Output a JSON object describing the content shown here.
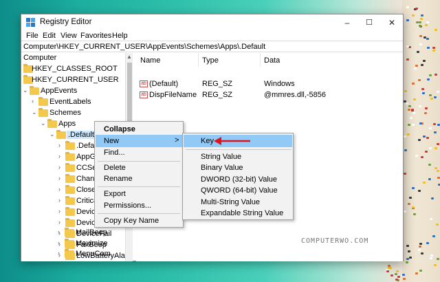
{
  "window": {
    "title": "Registry Editor",
    "minimize": "–",
    "maximize": "☐",
    "close": "✕"
  },
  "menubar": [
    "File",
    "Edit",
    "View",
    "Favorites",
    "Help"
  ],
  "address": "Computer\\HKEY_CURRENT_USER\\AppEvents\\Schemes\\Apps\\.Default",
  "tree": {
    "items": [
      {
        "label": "Computer",
        "indent": 0
      },
      {
        "label": "HKEY_CLASSES_ROOT",
        "indent": 1,
        "arrow": ">"
      },
      {
        "label": "HKEY_CURRENT_USER",
        "indent": 1,
        "arrow": "v"
      },
      {
        "label": "AppEvents",
        "indent": 2,
        "arrow": "v"
      },
      {
        "label": "EventLabels",
        "indent": 3,
        "arrow": ">"
      },
      {
        "label": "Schemes",
        "indent": 3,
        "arrow": "v"
      },
      {
        "label": "Apps",
        "indent": 4,
        "arrow": "v"
      },
      {
        "label": ".Default",
        "indent": 5,
        "arrow": "v",
        "selected": true
      },
      {
        "label": ".Default",
        "indent": 6,
        "arrow": ">"
      },
      {
        "label": "AppGPF",
        "indent": 6,
        "arrow": ">"
      },
      {
        "label": "CCSelect",
        "indent": 6,
        "arrow": ">"
      },
      {
        "label": "ChangeTheme",
        "indent": 6,
        "arrow": ">"
      },
      {
        "label": "Close",
        "indent": 6,
        "arrow": ">"
      },
      {
        "label": "CriticalBatteryAlarm",
        "indent": 6,
        "arrow": ">"
      },
      {
        "label": "DeviceConnect",
        "indent": 6,
        "arrow": ">"
      },
      {
        "label": "DeviceDisconnect",
        "indent": 6,
        "arrow": ">"
      },
      {
        "label": "DeviceFail",
        "indent": 6,
        "arrow": ">"
      },
      {
        "label": "FaxBeep",
        "indent": 6,
        "arrow": ">"
      },
      {
        "label": "LowBatteryAlarm",
        "indent": 6,
        "arrow": ">"
      },
      {
        "label": "MailBeep",
        "indent": 6,
        "arrow": ">"
      },
      {
        "label": "Maximize",
        "indent": 6,
        "arrow": ">"
      },
      {
        "label": "MenuCommand",
        "indent": 6,
        "arrow": ">"
      }
    ]
  },
  "list": {
    "columns": [
      "Name",
      "Type",
      "Data"
    ],
    "rows": [
      {
        "name": "(Default)",
        "type": "REG_SZ",
        "data": "Windows"
      },
      {
        "name": "DispFileName",
        "type": "REG_SZ",
        "data": "@mmres.dll,-5856"
      }
    ]
  },
  "context_menu": {
    "items": [
      "Collapse",
      "New",
      "Find...",
      "Delete",
      "Rename",
      "Export",
      "Permissions...",
      "Copy Key Name"
    ],
    "submenu_arrow": ">"
  },
  "submenu": {
    "items": [
      "Key",
      "String Value",
      "Binary Value",
      "DWORD (32-bit) Value",
      "QWORD (64-bit) Value",
      "Multi-String Value",
      "Expandable String Value"
    ]
  },
  "watermark": "COMPUTERWO.COM",
  "colors": {
    "highlight": "#91c9f7",
    "arrow_annotation": "#e0141e",
    "folder": "#f4c84d"
  }
}
